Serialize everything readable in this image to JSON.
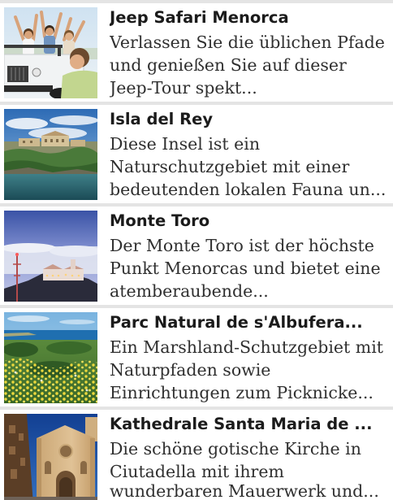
{
  "list": {
    "items": [
      {
        "title": "Jeep Safari Menorca",
        "description_lines": [
          "Verlassen Sie die üblichen Pfade",
          "und genießen Sie auf dieser",
          "Jeep-Tour spekt..."
        ],
        "thumbnail": "jeep-safari-photo"
      },
      {
        "title": "Isla del Rey",
        "description_lines": [
          "Diese Insel ist ein",
          "Naturschutzgebiet mit einer",
          "bedeutenden lokalen Fauna un..."
        ],
        "thumbnail": "island-coast-photo"
      },
      {
        "title": "Monte Toro",
        "description_lines": [
          "Der Monte Toro ist der höchste",
          "Punkt Menorcas und bietet eine",
          "atemberaubende..."
        ],
        "thumbnail": "mountain-sanctuary-photo"
      },
      {
        "title": "Parc Natural de s'Albufera...",
        "description_lines": [
          "Ein Marshland-Schutzgebiet mit",
          "Naturpfaden sowie",
          "Einrichtungen zum Picknicke..."
        ],
        "thumbnail": "wetland-flowers-photo"
      },
      {
        "title": "Kathedrale Santa Maria de ...",
        "description_lines": [
          "Die schöne gotische Kirche in",
          "Ciutadella mit ihrem",
          "wunderbaren Mauerwerk und..."
        ],
        "thumbnail": "cathedral-facade-photo"
      }
    ]
  },
  "colors": {
    "separator": "#e4e4e4",
    "title": "#1b1b1b",
    "description": "#303030",
    "background": "#ffffff"
  }
}
